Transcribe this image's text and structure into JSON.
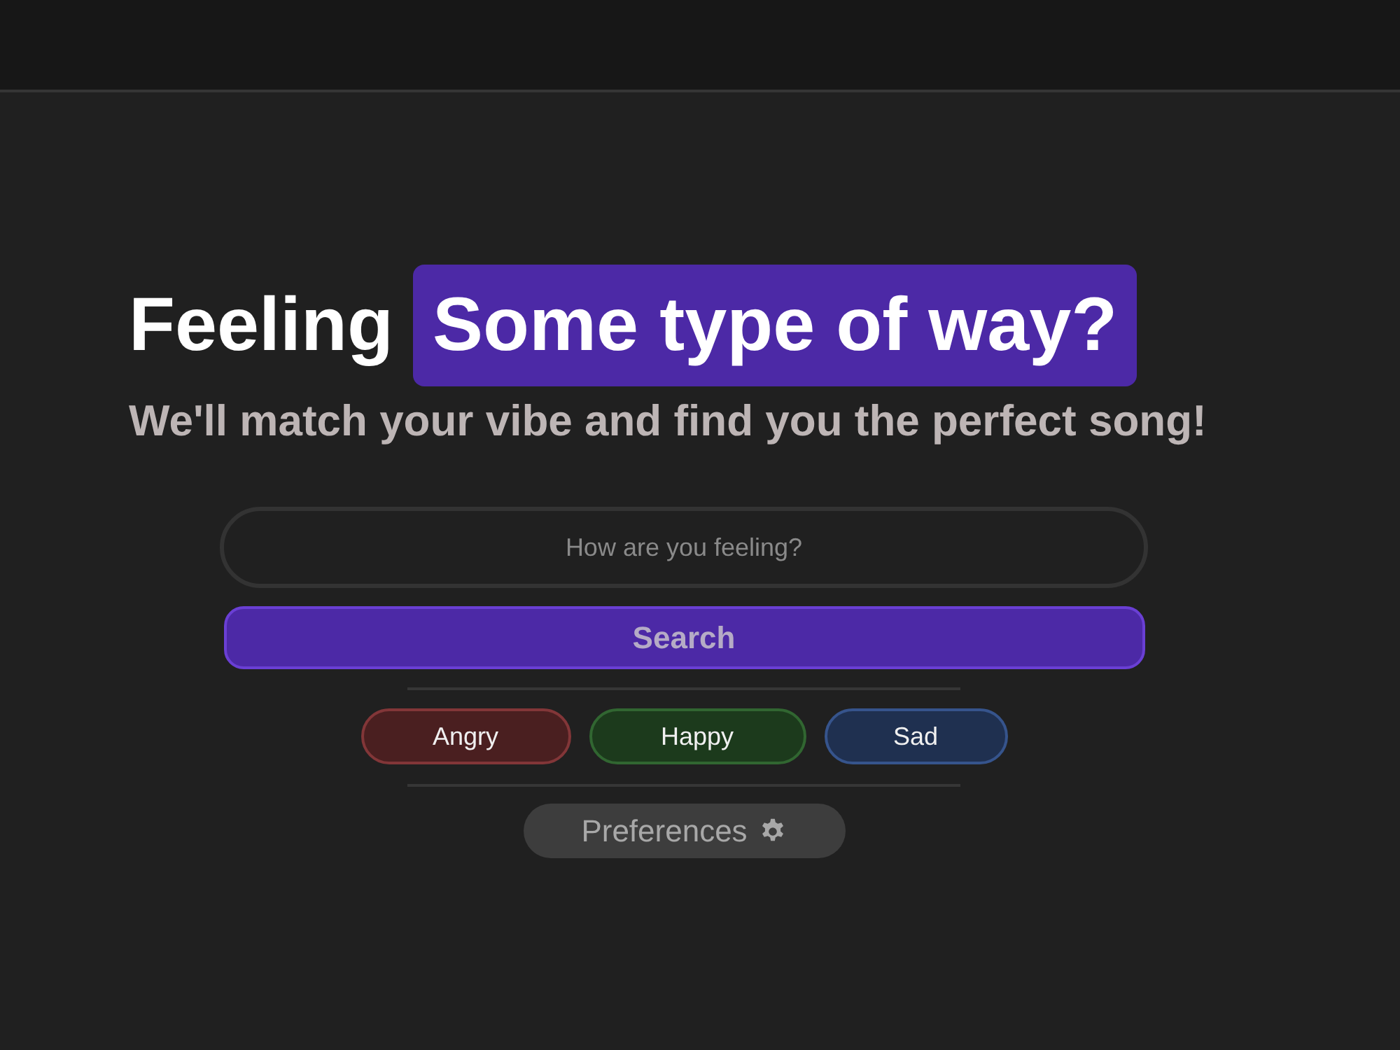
{
  "headline": {
    "lead": "Feeling",
    "highlight": "Some type of way?"
  },
  "subtitle": "We'll match your vibe and find you the perfect song!",
  "search": {
    "placeholder": "How are you feeling?",
    "button": "Search"
  },
  "moods": [
    {
      "label": "Angry",
      "color": "#4a1f20"
    },
    {
      "label": "Happy",
      "color": "#1c3a1c"
    },
    {
      "label": "Sad",
      "color": "#1f3050"
    }
  ],
  "preferences_button": "Preferences"
}
